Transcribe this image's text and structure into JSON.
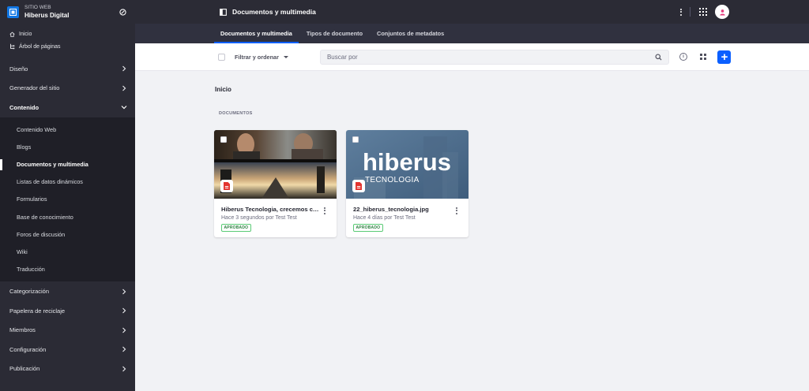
{
  "sidebar": {
    "site_kicker": "SITIO WEB",
    "site_name": "Hiberus Digital",
    "quick_links": [
      {
        "label": "Inicio",
        "icon": "home-icon"
      },
      {
        "label": "Árbol de páginas",
        "icon": "sitemap-icon"
      }
    ],
    "sections_top": [
      {
        "label": "Diseño"
      },
      {
        "label": "Generador del sitio"
      }
    ],
    "active_section": "Contenido",
    "content_items": [
      {
        "label": "Contenido Web"
      },
      {
        "label": "Blogs"
      },
      {
        "label": "Documentos y multimedia"
      },
      {
        "label": "Listas de datos dinámicos"
      },
      {
        "label": "Formularios"
      },
      {
        "label": "Base de conocimiento"
      },
      {
        "label": "Foros de discusión"
      },
      {
        "label": "Wiki"
      },
      {
        "label": "Traducción"
      }
    ],
    "sections_bottom": [
      {
        "label": "Categorización"
      },
      {
        "label": "Papelera de reciclaje"
      },
      {
        "label": "Miembros"
      },
      {
        "label": "Configuración"
      },
      {
        "label": "Publicación"
      }
    ]
  },
  "topbar": {
    "title": "Documentos y multimedia"
  },
  "tabs": [
    {
      "label": "Documentos y multimedia",
      "active": true
    },
    {
      "label": "Tipos de documento",
      "active": false
    },
    {
      "label": "Conjuntos de metadatos",
      "active": false
    }
  ],
  "toolbar": {
    "filter_label": "Filtrar y ordenar",
    "search_placeholder": "Buscar por"
  },
  "main": {
    "breadcrumb": "Inicio",
    "section_label": "DOCUMENTOS",
    "cards": [
      {
        "title": "Hiberus Tecnologia, crecemos co...",
        "subtitle": "Hace 3 segundos por Test Test",
        "status": "APROBADO"
      },
      {
        "title": "22_hiberus_tecnologia.jpg",
        "subtitle": "Hace 4 días por Test Test",
        "status": "APROBADO",
        "logo_word": "hiberus",
        "logo_tag": "TECNOLOGIA"
      }
    ]
  },
  "colors": {
    "sidebar_bg": "#2b2b35",
    "sidebar_subpanel_bg": "#1f1f27",
    "accent": "#0b5fff",
    "approved": "#287d3c",
    "page_bg": "#f1f2f5"
  }
}
